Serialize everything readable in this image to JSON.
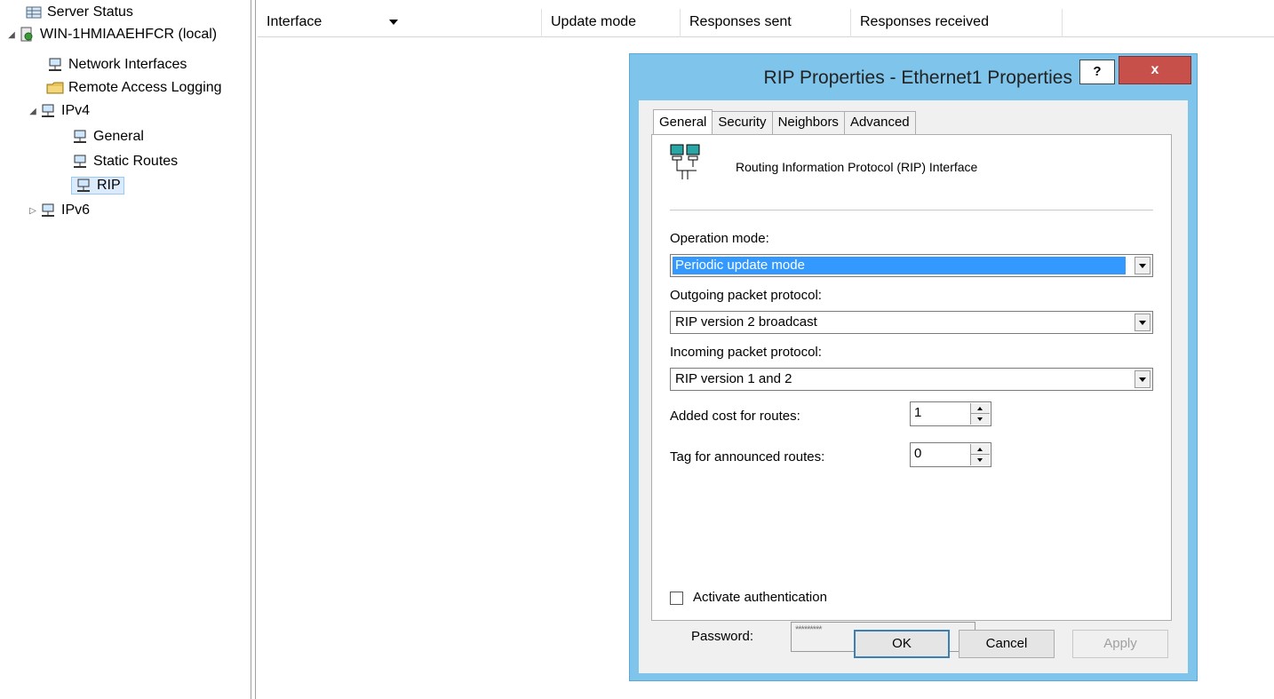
{
  "tree": {
    "items": [
      {
        "label": "Server Status",
        "icon": "server-status-icon",
        "arrow": ""
      },
      {
        "label": "WIN-1HMIAAEHFCR (local)",
        "icon": "server-icon",
        "arrow": "◢"
      },
      {
        "label": "Network Interfaces",
        "icon": "network-icon",
        "arrow": ""
      },
      {
        "label": "Remote Access Logging",
        "icon": "folder-icon",
        "arrow": ""
      },
      {
        "label": "IPv4",
        "icon": "network-icon",
        "arrow": "◢"
      },
      {
        "label": "General",
        "icon": "network-icon",
        "arrow": ""
      },
      {
        "label": "Static Routes",
        "icon": "network-icon",
        "arrow": ""
      },
      {
        "label": "RIP",
        "icon": "network-icon",
        "arrow": ""
      },
      {
        "label": "IPv6",
        "icon": "network-icon",
        "arrow": "▷"
      }
    ]
  },
  "list": {
    "columns": [
      "Interface",
      "Update mode",
      "Responses sent",
      "Responses received"
    ]
  },
  "dialog": {
    "title": "RIP Properties - Ethernet1 Properties",
    "help": "?",
    "close": "x",
    "tabs": [
      "General",
      "Security",
      "Neighbors",
      "Advanced"
    ],
    "header_text": "Routing Information Protocol (RIP) Interface",
    "operation_mode_label": "Operation mode:",
    "operation_mode_value": "Periodic update mode",
    "outgoing_label": "Outgoing packet protocol:",
    "outgoing_value": "RIP version 2 broadcast",
    "incoming_label": "Incoming packet protocol:",
    "incoming_value": "RIP version 1 and 2",
    "cost_label": "Added cost for routes:",
    "cost_value": "1",
    "tag_label": "Tag for announced routes:",
    "tag_value": "0",
    "auth_label": "Activate authentication",
    "password_label": "Password:",
    "password_value": "*********",
    "ok": "OK",
    "cancel": "Cancel",
    "apply": "Apply"
  },
  "colors": {
    "dialog_frame": "#7fc4ea",
    "close_button": "#c7504b",
    "selection": "#3399ff"
  }
}
